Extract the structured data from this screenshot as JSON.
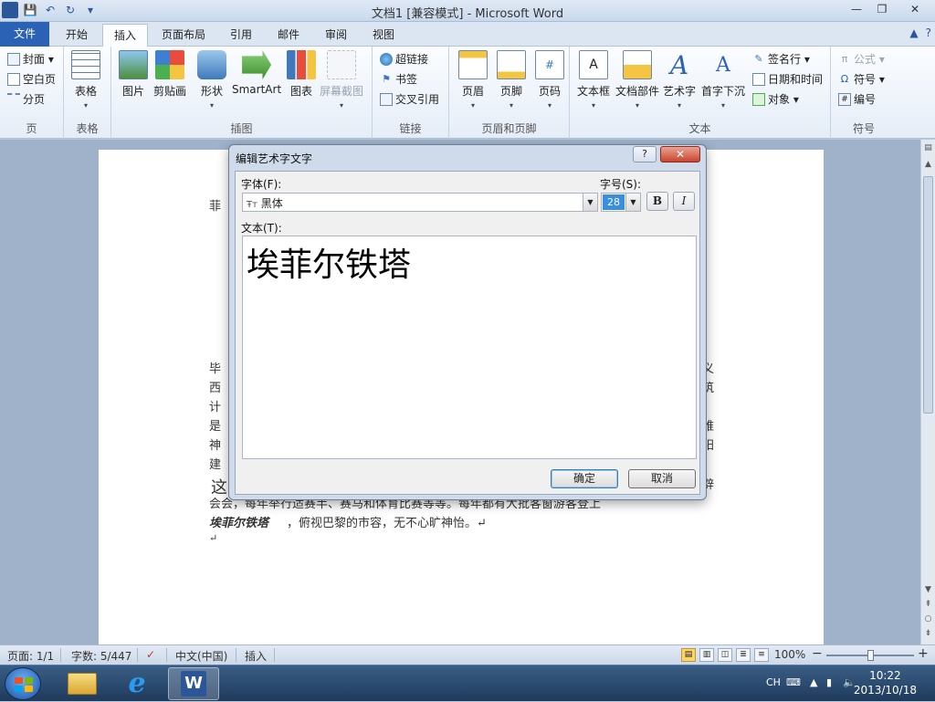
{
  "window": {
    "title": "文档1 [兼容模式] - Microsoft Word",
    "minimize_glyph": "—",
    "restore_glyph": "❐",
    "close_glyph": "✕"
  },
  "qat": {
    "word_logo": "W",
    "save": "💾",
    "undo": "↶",
    "redo": "↻",
    "customize": "▾"
  },
  "tabs": [
    {
      "label": "文件"
    },
    {
      "label": "开始"
    },
    {
      "label": "插入"
    },
    {
      "label": "页面布局"
    },
    {
      "label": "引用"
    },
    {
      "label": "邮件"
    },
    {
      "label": "审阅"
    },
    {
      "label": "视图"
    }
  ],
  "active_tab": "插入",
  "ribbon": {
    "pages": {
      "label": "页",
      "items": [
        "封面 ▾",
        "空白页",
        "分页"
      ]
    },
    "tables": {
      "label": "表格",
      "item": "表格"
    },
    "illustrations": {
      "label": "插图",
      "items": [
        "图片",
        "剪贴画",
        "形状",
        "SmartArt",
        "图表",
        "屏幕截图"
      ]
    },
    "links": {
      "label": "链接",
      "items": [
        "超链接",
        "书签",
        "交叉引用"
      ]
    },
    "header_footer": {
      "label": "页眉和页脚",
      "items": [
        "页眉",
        "页脚",
        "页码"
      ]
    },
    "text": {
      "label": "文本",
      "items": [
        "文本框",
        "文档部件",
        "艺术字",
        "首字下沉"
      ],
      "small_items": [
        "签名行 ▾",
        "日期和时间",
        "对象 ▾"
      ]
    },
    "symbols": {
      "label": "符号",
      "items": [
        "公式 ▾",
        "符号 ▾",
        "编号"
      ]
    }
  },
  "document": {
    "line_top": "菲",
    "lines": [
      {
        "left": "毕",
        "right": "义"
      },
      {
        "left": "西",
        "right": "筑"
      },
      {
        "left": "计",
        "right": "、"
      },
      {
        "left": "是",
        "right": "维"
      },
      {
        "left": "神",
        "right": "阳"
      },
      {
        "left": "建",
        "right": ""
      }
    ],
    "line_7_left": "这",
    "line_7_right": "辟",
    "line_8": "会会，每年举行适赛半、赛马和体育比赛等等。每年都有大批客窗游客登上",
    "line_9_bold": "埃菲尔铁塔",
    "line_9_rest": "，俯视巴黎的市容，无不心旷神怡。↵",
    "line_10": "↵"
  },
  "dialog": {
    "title": "编辑艺术字文字",
    "help": "?",
    "close": "✕",
    "font_label": "字体(F):",
    "size_label": "字号(S):",
    "font_value": "黑体",
    "font_icon": "Ŧт",
    "size_value": "28",
    "bold": "B",
    "italic": "I",
    "text_label": "文本(T):",
    "text_value": "埃菲尔铁塔",
    "ok": "确定",
    "cancel": "取消"
  },
  "statusbar": {
    "page": "页面: 1/1",
    "words": "字数: 5/447",
    "language": "中文(中国)",
    "mode": "插入",
    "zoom": "100%",
    "zoom_minus": "−",
    "zoom_plus": "+"
  },
  "taskbar": {
    "ime": "CH",
    "time": "10:22",
    "date": "2013/10/18"
  }
}
